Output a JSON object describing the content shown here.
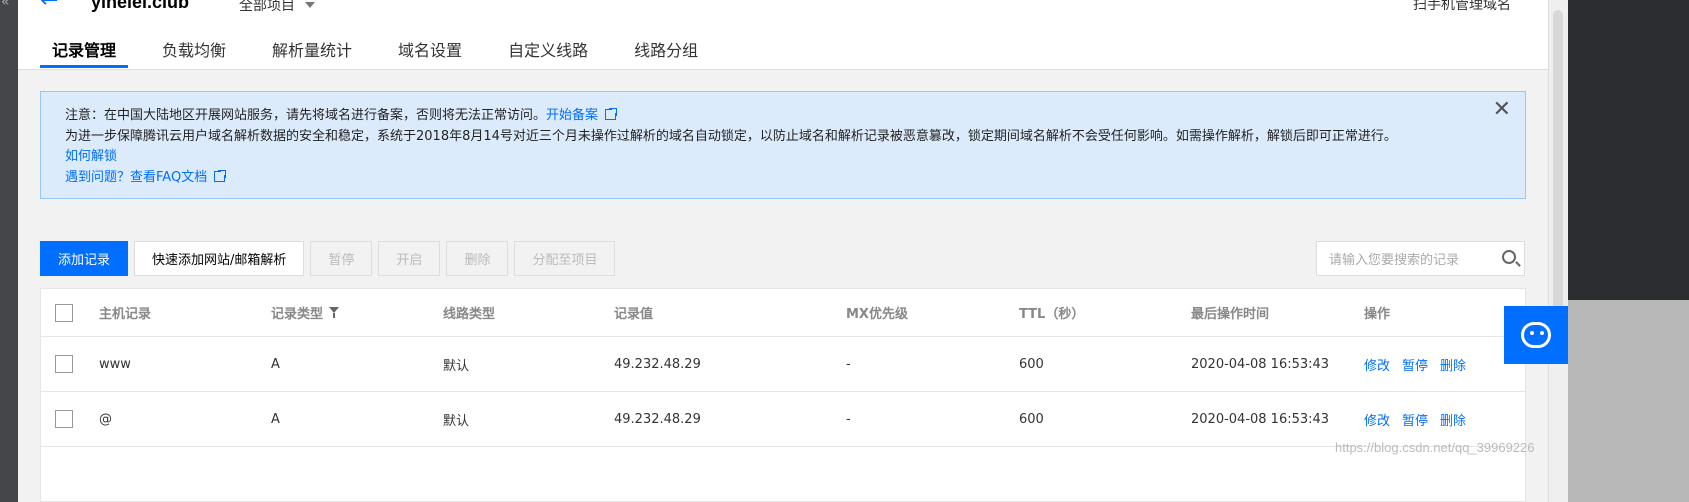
{
  "header": {
    "domain": "yinelei.club",
    "project_select": "全部项目",
    "mobile_manage": "扫手机管理域名"
  },
  "tabs": [
    {
      "label": "记录管理",
      "active": true
    },
    {
      "label": "负载均衡"
    },
    {
      "label": "解析量统计"
    },
    {
      "label": "域名设置"
    },
    {
      "label": "自定义线路"
    },
    {
      "label": "线路分组"
    }
  ],
  "notice": {
    "line1": "注意：在中国大陆地区开展网站服务，请先将域名进行备案，否则将无法正常访问。",
    "line1_link": "开始备案",
    "line2": "为进一步保障腾讯云用户域名解析数据的安全和稳定，系统于2018年8月14号对近三个月未操作过解析的域名自动锁定，以防止域名和解析记录被恶意篡改，锁定期间域名解析不会受任何影响。如需操作解析，解锁后即可正常进行。",
    "line3_link": "如何解锁",
    "line4_prefix": "遇到问题？",
    "line4_link": "查看FAQ文档",
    "close": "✕"
  },
  "toolbar": {
    "add": "添加记录",
    "quick_add": "快速添加网站/邮箱解析",
    "pause": "暂停",
    "enable": "开启",
    "delete": "删除",
    "assign": "分配至项目",
    "search_placeholder": "请输入您要搜索的记录"
  },
  "table": {
    "headers": [
      "主机记录",
      "记录类型",
      "线路类型",
      "记录值",
      "MX优先级",
      "TTL（秒）",
      "最后操作时间",
      "操作"
    ],
    "rows": [
      {
        "host": "www",
        "type": "A",
        "line": "默认",
        "value": "49.232.48.29",
        "mx": "-",
        "ttl": "600",
        "time": "2020-04-08 16:53:43",
        "op_edit": "修改",
        "op_pause": "暂停",
        "op_delete": "删除"
      },
      {
        "host": "@",
        "type": "A",
        "line": "默认",
        "value": "49.232.48.29",
        "mx": "-",
        "ttl": "600",
        "time": "2020-04-08 16:53:43",
        "op_edit": "修改",
        "op_pause": "暂停",
        "op_delete": "删除"
      }
    ]
  },
  "watermark": "https://blog.csdn.net/qq_39969226",
  "colors": {
    "accent": "#006eff",
    "notice_bg": "#dcebfb"
  }
}
